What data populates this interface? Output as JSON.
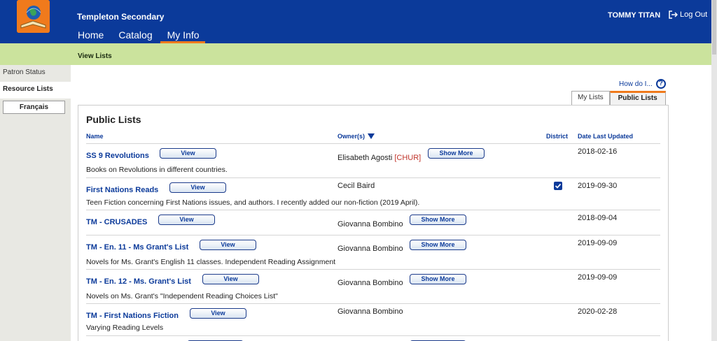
{
  "header": {
    "school_name": "Templeton Secondary",
    "user_name": "TOMMY TITAN",
    "logout_label": "Log Out",
    "nav": [
      "Home",
      "Catalog",
      "My Info"
    ],
    "brand_color": "#0b3a9a",
    "accent_color": "#f07a1c"
  },
  "subbar": {
    "title": "View Lists"
  },
  "sidebar": {
    "items": [
      "Patron Status",
      "Resource Lists"
    ],
    "language_button": "Français"
  },
  "help": {
    "label": "How do I...",
    "icon": "question-icon"
  },
  "tabs": [
    "My Lists",
    "Public Lists"
  ],
  "panel": {
    "title": "Public Lists",
    "columns": {
      "name": "Name",
      "owner": "Owner(s)",
      "district": "District",
      "date": "Date Last Updated"
    },
    "view_label": "View",
    "show_more_label": "Show More"
  },
  "rows": [
    {
      "title": "SS 9 Revolutions",
      "owner": "Elisabeth Agosti",
      "owner_tag": "[CHUR]",
      "district": false,
      "date": "2018-02-16",
      "description": "Books on Revolutions in different countries.",
      "show_more": true
    },
    {
      "title": "First Nations Reads",
      "owner": "Cecil Baird",
      "owner_tag": "",
      "district": true,
      "date": "2019-09-30",
      "description": "Teen Fiction concerning First Nations issues, and authors. I recently added our non-fiction (2019 April).",
      "show_more": false
    },
    {
      "title": "TM - CRUSADES",
      "owner": "Giovanna Bombino",
      "owner_tag": "",
      "district": false,
      "date": "2018-09-04",
      "description": "",
      "show_more": true
    },
    {
      "title": "TM - En. 11 - Ms Grant's List",
      "owner": "Giovanna Bombino",
      "owner_tag": "",
      "district": false,
      "date": "2019-09-09",
      "description": "Novels for Ms. Grant's English 11 classes. Independent Reading Assignment",
      "show_more": true
    },
    {
      "title": "TM - En. 12 - Ms. Grant's List",
      "owner": "Giovanna Bombino",
      "owner_tag": "",
      "district": false,
      "date": "2019-09-09",
      "description": "Novels on Ms. Grant's \"Independent Reading Choices List\"",
      "show_more": true
    },
    {
      "title": "TM - First Nations Fiction",
      "owner": "Giovanna Bombino",
      "owner_tag": "",
      "district": false,
      "date": "2020-02-28",
      "description": "Varying Reading Levels",
      "show_more": false
    }
  ]
}
